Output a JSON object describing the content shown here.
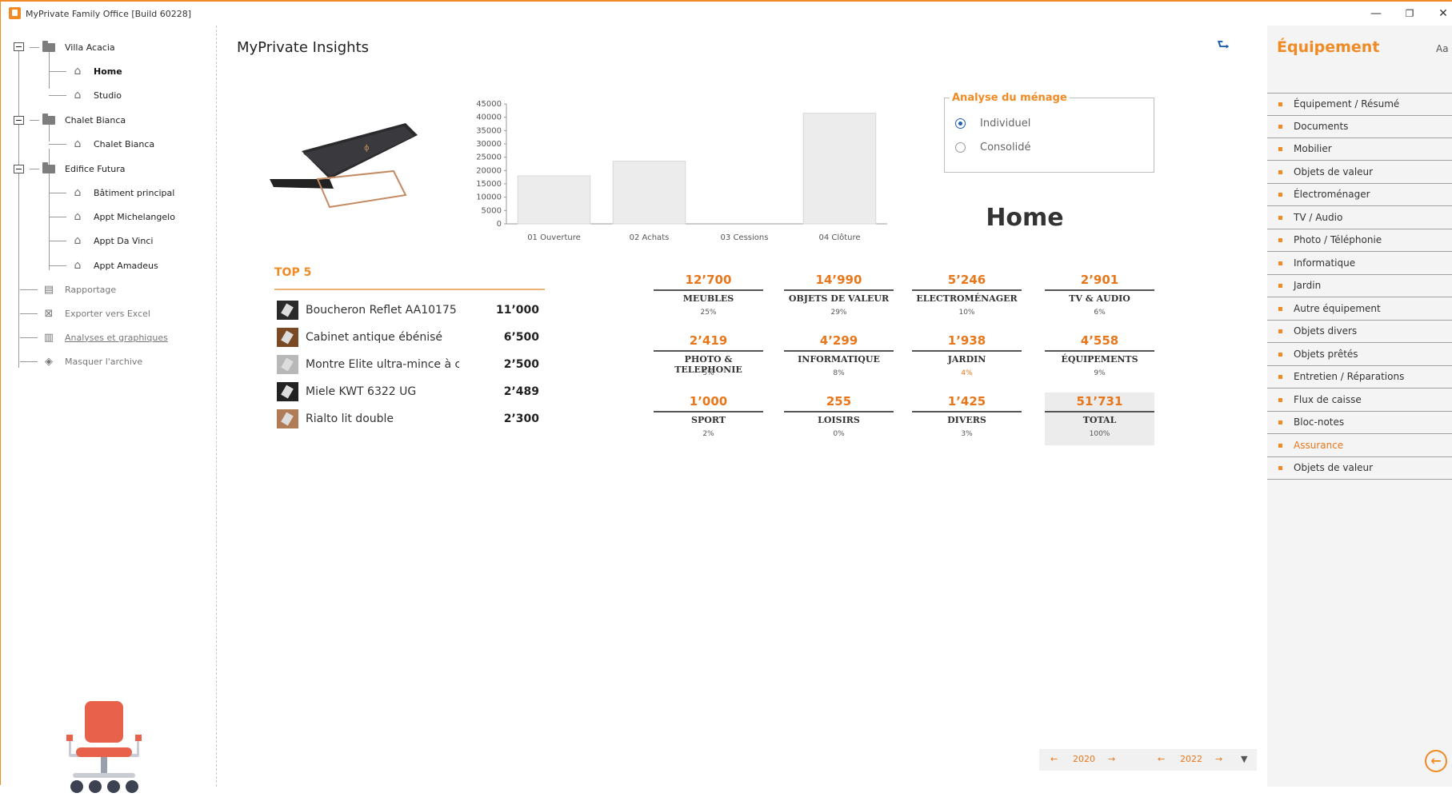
{
  "window": {
    "title": "MyPrivate Family Office [Build 60228]",
    "minimize": "—",
    "restore": "❐",
    "close": "✕"
  },
  "tree": {
    "groups": [
      {
        "label": "Villa Acacia",
        "children": [
          "Home",
          "Studio"
        ]
      },
      {
        "label": "Chalet Bianca",
        "children": [
          "Chalet Bianca"
        ]
      },
      {
        "label": "Edifice Futura",
        "children": [
          "Bâtiment principal",
          "Appt Michelangelo",
          "Appt Da Vinci",
          "Appt Amadeus"
        ]
      }
    ],
    "actions": [
      "Rapportage",
      "Exporter vers Excel",
      "Analyses et graphiques",
      "Masquer l'archive"
    ]
  },
  "main": {
    "title": "MyPrivate Insights",
    "selected_object": "Home"
  },
  "chart_data": {
    "type": "bar",
    "categories": [
      "01 Ouverture",
      "02 Achats",
      "03 Cessions",
      "04 Clôture"
    ],
    "values": [
      18000,
      23500,
      0,
      41500
    ],
    "ylim": [
      0,
      45000
    ],
    "yticks": [
      "45000",
      "40000",
      "35000",
      "30000",
      "25000",
      "20000",
      "15000",
      "10000",
      "5000",
      "0"
    ],
    "title": "",
    "xlabel": "",
    "ylabel": "",
    "bar_color": "#ececec"
  },
  "analysis": {
    "legend": "Analyse du ménage",
    "options": [
      "Individuel",
      "Consolidé"
    ],
    "selected": "Individuel"
  },
  "top5": {
    "title": "TOP 5",
    "items": [
      {
        "name": "Boucheron Reflet AA10175",
        "value": "11’000"
      },
      {
        "name": "Cabinet antique ébénisé",
        "value": "6’500"
      },
      {
        "name": "Montre Elite ultra-mince à ca",
        "value": "2’500"
      },
      {
        "name": "Miele KWT 6322 UG",
        "value": "2’489"
      },
      {
        "name": "Rialto lit double",
        "value": "2’300"
      }
    ]
  },
  "kpis": [
    {
      "value": "12’700",
      "label": "MEUBLES",
      "pct": "25%"
    },
    {
      "value": "14’990",
      "label": "OBJETS DE VALEUR",
      "pct": "29%"
    },
    {
      "value": "5’246",
      "label": "ELECTROMÉNAGER",
      "pct": "10%"
    },
    {
      "value": "2’901",
      "label": "TV & AUDIO",
      "pct": "6%"
    },
    {
      "value": "2’419",
      "label": "PHOTO & TELEPHONIE",
      "pct": "5%"
    },
    {
      "value": "4’299",
      "label": "INFORMATIQUE",
      "pct": "8%"
    },
    {
      "value": "1’938",
      "label": "JARDIN",
      "pct": "4%"
    },
    {
      "value": "4’558",
      "label": "ÉQUIPEMENTS",
      "pct": "9%"
    },
    {
      "value": "1’000",
      "label": "SPORT",
      "pct": "2%"
    },
    {
      "value": "255",
      "label": "LOISIRS",
      "pct": "0%"
    },
    {
      "value": "1’425",
      "label": "DIVERS",
      "pct": "3%"
    },
    {
      "value": "51’731",
      "label": "TOTAL",
      "pct": "100%"
    }
  ],
  "pager": {
    "year_from": "2020",
    "year_to": "2022"
  },
  "right_panel": {
    "title": "Équipement",
    "font_toggle": "Aa",
    "items": [
      "Équipement / Résumé",
      "Documents",
      "Mobilier",
      "Objets de valeur",
      "Électroménager",
      "TV / Audio",
      "Photo / Téléphonie",
      "Informatique",
      "Jardin",
      "Autre équipement",
      "Objets divers",
      "Objets prêtés",
      "Entretien / Réparations",
      "Flux de caisse",
      "Bloc-notes",
      "Assurance",
      "Objets de valeur"
    ],
    "highlighted": "Assurance"
  },
  "colors": {
    "accent": "#f08a24",
    "kpi_value": "#e8771c",
    "link_blue": "#1f5fb0",
    "chair": "#e8614a"
  }
}
